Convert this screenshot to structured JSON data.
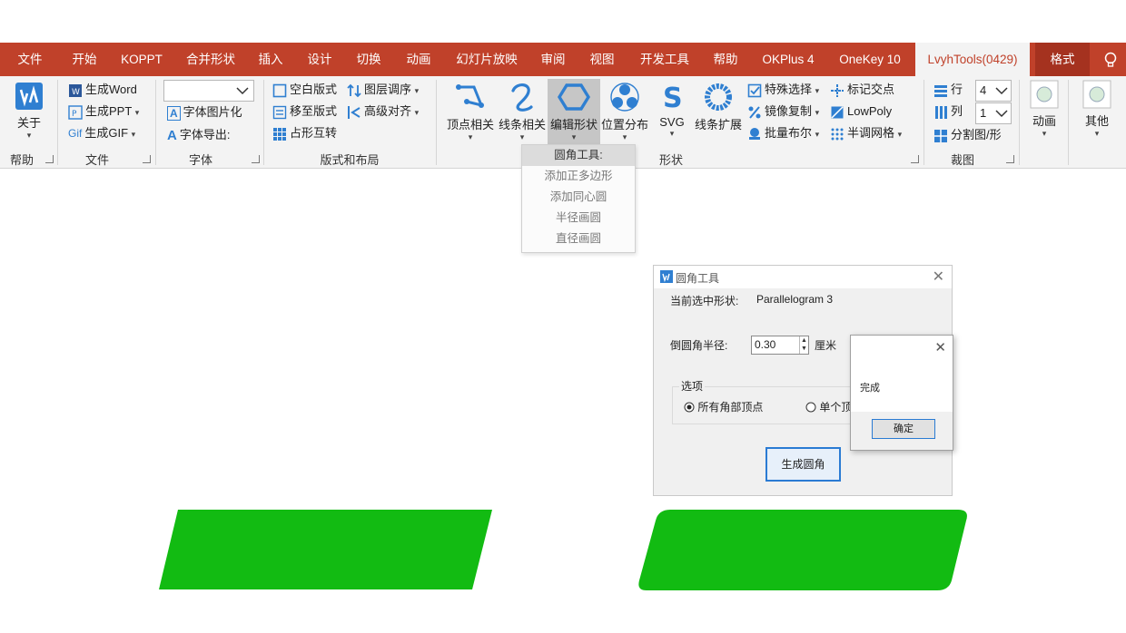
{
  "tabs": [
    "文件",
    "开始",
    "KOPPT",
    "合并形状",
    "插入",
    "设计",
    "切换",
    "动画",
    "幻灯片放映",
    "审阅",
    "视图",
    "开发工具",
    "帮助",
    "OKPlus 4",
    "OneKey 10",
    "LvyhTools(0429)",
    "格式"
  ],
  "active_tab": "LvyhTools(0429)",
  "groups": {
    "help": {
      "label": "帮助",
      "about": "关于"
    },
    "file": {
      "label": "文件",
      "items": [
        "生成Word",
        "生成PPT",
        "生成GIF"
      ]
    },
    "font": {
      "label": "字体",
      "items": [
        "字体图片化",
        "字体导出:"
      ]
    },
    "layout": {
      "label": "版式和布局",
      "items": [
        "空白版式",
        "移至版式",
        "占形互转",
        "图层调序",
        "高级对齐"
      ]
    },
    "shape": {
      "label": "形状",
      "big": [
        "顶点相关",
        "线条相关",
        "编辑形状",
        "位置分布",
        "SVG",
        "线条扩展"
      ],
      "small": [
        "特殊选择",
        "镜像复制",
        "批量布尔",
        "标记交点",
        "LowPoly",
        "半调网格"
      ]
    },
    "crop": {
      "label": "裁图",
      "rows_label": "行",
      "cols_label": "列",
      "rows_value": "4",
      "cols_value": "1",
      "split": "分割图/形"
    },
    "anim": {
      "label": "动画"
    },
    "other": {
      "label": "其他"
    }
  },
  "dropdown": {
    "header": "圆角工具:",
    "items": [
      "添加正多边形",
      "添加同心圆",
      "半径画圆",
      "直径画圆"
    ]
  },
  "dialog": {
    "title": "圆角工具",
    "selected_label": "当前选中形状:",
    "selected_value": "Parallelogram 3",
    "radius_label": "倒圆角半径:",
    "radius_value": "0.30",
    "unit": "厘米",
    "options_label": "选项",
    "option_all": "所有角部顶点",
    "option_single": "单个顶",
    "generate": "生成圆角"
  },
  "msgbox": {
    "text": "完成",
    "ok": "确定"
  },
  "colors": {
    "tabbar": "#c0412a",
    "accent": "#2a7bd3",
    "shape_green": "#12bb12"
  }
}
